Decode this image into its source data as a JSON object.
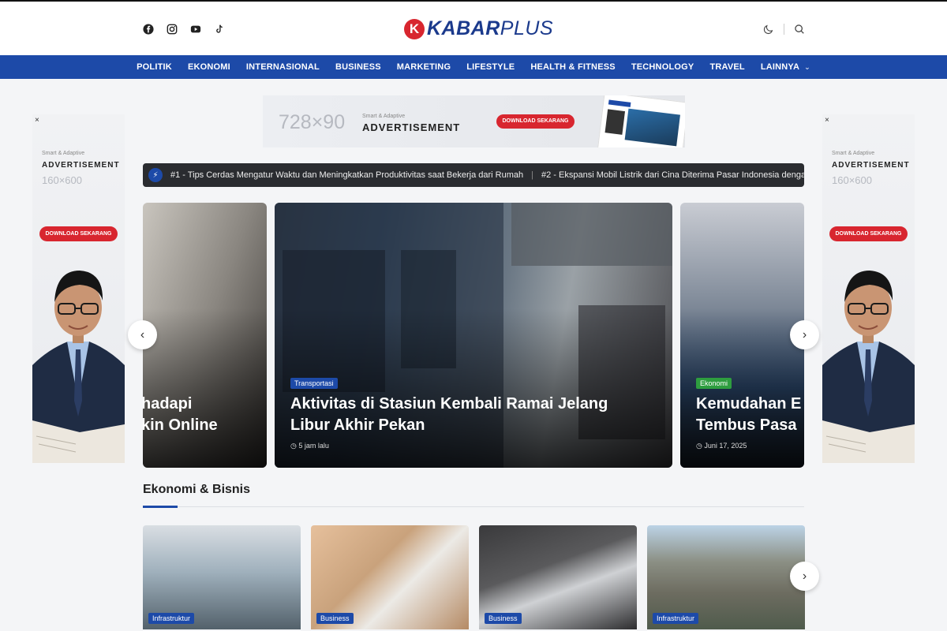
{
  "header": {
    "logo_letter": "K",
    "logo_bold": "KABAR",
    "logo_light": "PLUS",
    "social_icons": [
      "facebook-icon",
      "instagram-icon",
      "youtube-icon",
      "tiktok-icon"
    ],
    "tool_icons": [
      "moon-icon",
      "search-icon"
    ]
  },
  "nav": {
    "items": [
      "POLITIK",
      "EKONOMI",
      "INTERNASIONAL",
      "BUSINESS",
      "MARKETING",
      "LIFESTYLE",
      "HEALTH & FITNESS",
      "TECHNOLOGY",
      "TRAVEL",
      "LAINNYA"
    ],
    "more_icon": "chevron-down-icon"
  },
  "top_ad": {
    "size": "728×90",
    "kicker": "Smart & Adaptive",
    "title": "ADVERTISEMENT",
    "button": "DOWNLOAD SEKARANG"
  },
  "side_ad": {
    "close": "×",
    "kicker": "Smart & Adaptive",
    "title": "ADVERTISEMENT",
    "size": "160×600",
    "button": "DOWNLOAD SEKARANG"
  },
  "ticker": {
    "items": [
      "#1 - Tips Cerdas Mengatur Waktu dan Meningkatkan Produktivitas saat Bekerja dari Rumah",
      "#2 - Ekspansi Mobil Listrik dari Cina Diterima Pasar Indonesia dengan A"
    ],
    "separator": "|"
  },
  "slider": {
    "left": {
      "title_line1": "hadapi",
      "title_line2": "kin Online"
    },
    "center": {
      "category": "Transportasi",
      "category_color": "#1d4aa8",
      "title_line1": "Aktivitas di Stasiun Kembali Ramai Jelang",
      "title_line2": "Libur Akhir Pekan",
      "time": "5 jam lalu"
    },
    "right": {
      "category": "Ekonomi",
      "category_color": "#2e9d3f",
      "title_line1": "Kemudahan E",
      "title_line2": "Tembus Pasa",
      "time": "Juni 17, 2025"
    },
    "prev_icon": "‹",
    "next_icon": "›"
  },
  "section": {
    "title": "Ekonomi & Bisnis",
    "cards": [
      {
        "category": "Infrastruktur"
      },
      {
        "category": "Business"
      },
      {
        "category": "Business"
      },
      {
        "category": "Infrastruktur"
      }
    ],
    "next_icon": "›"
  }
}
